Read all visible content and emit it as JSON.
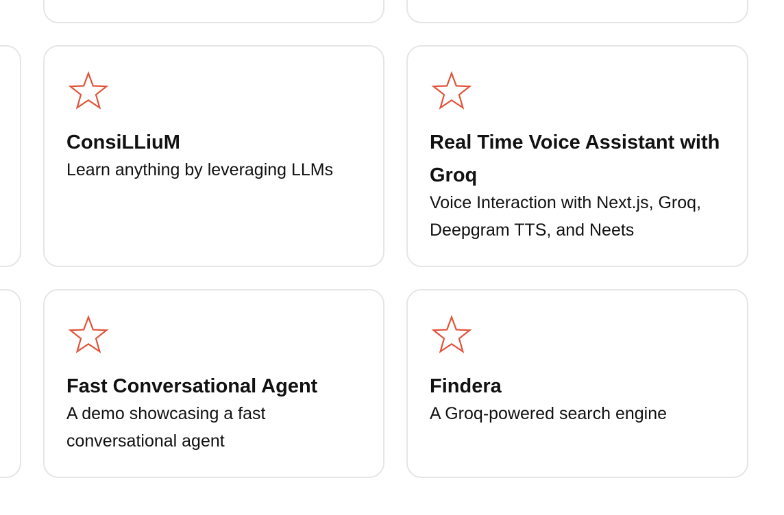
{
  "accent_color": "#e0533a",
  "icon": "star-outline-icon",
  "cards": [
    {
      "title": "ConsiLLiuM",
      "description": "Learn anything by leveraging LLMs"
    },
    {
      "title": "Real Time Voice Assistant with Groq",
      "description": "Voice Interaction with Next.js, Groq, Deepgram TTS, and Neets"
    },
    {
      "title": "Fast Conversational Agent",
      "description": "A demo showcasing a fast conversational agent"
    },
    {
      "title": "Findera",
      "description": "A Groq-powered search engine"
    }
  ]
}
